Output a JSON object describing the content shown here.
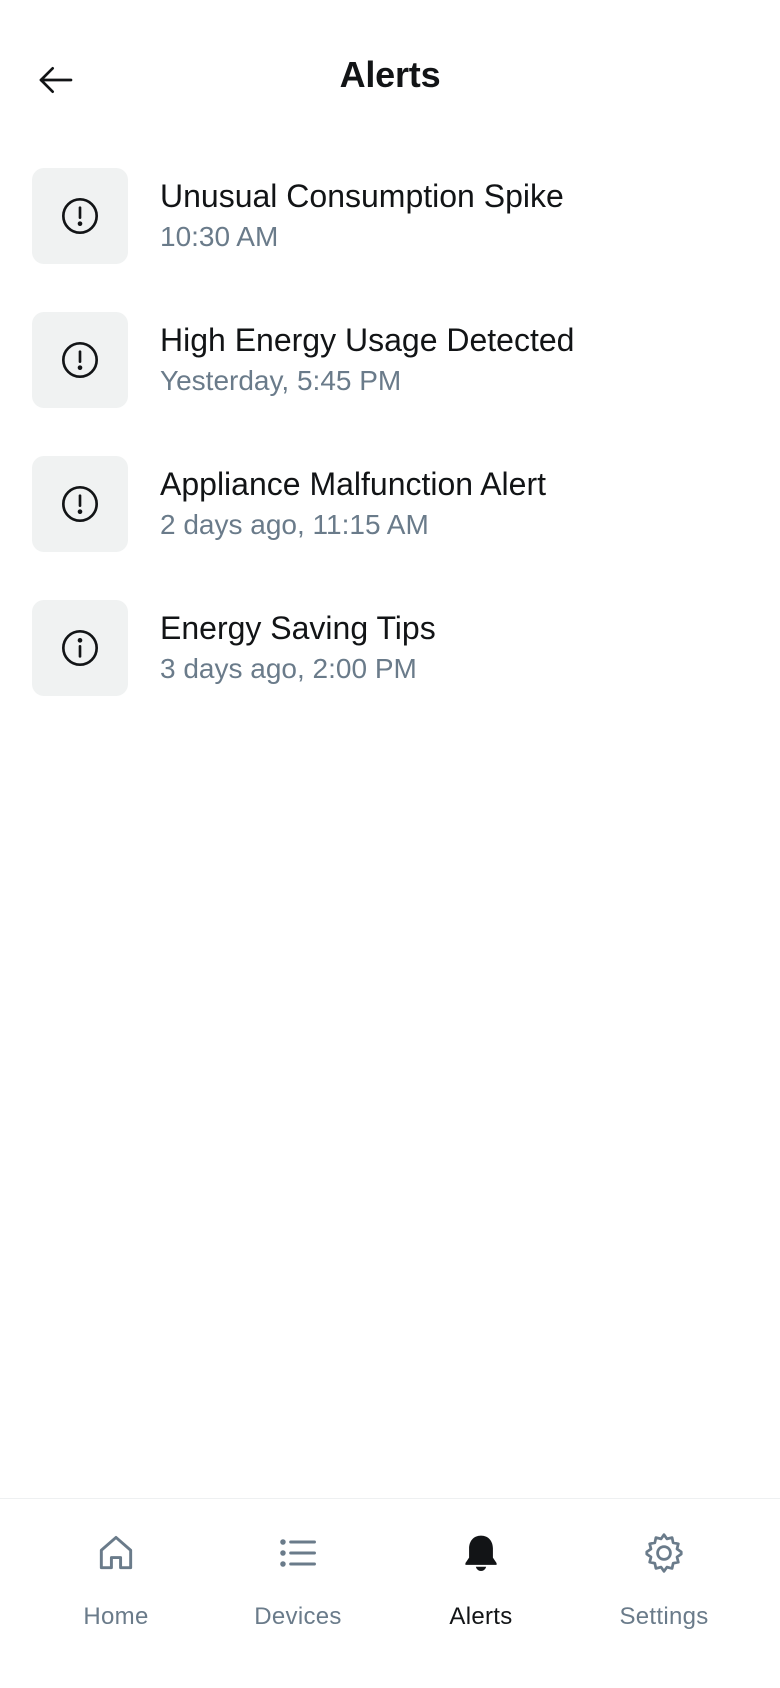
{
  "header": {
    "title": "Alerts",
    "back_icon": "arrow-left-icon"
  },
  "alerts": [
    {
      "title": "Unusual Consumption Spike",
      "time": "10:30 AM",
      "icon": "exclamation-circle-icon"
    },
    {
      "title": "High Energy Usage Detected",
      "time": "Yesterday, 5:45 PM",
      "icon": "exclamation-circle-icon"
    },
    {
      "title": "Appliance Malfunction Alert",
      "time": "2 days ago, 11:15 AM",
      "icon": "exclamation-circle-icon"
    },
    {
      "title": "Energy Saving Tips",
      "time": "3 days ago, 2:00 PM",
      "icon": "info-circle-icon"
    }
  ],
  "nav": {
    "items": [
      {
        "label": "Home",
        "icon": "house-icon",
        "active": false
      },
      {
        "label": "Devices",
        "icon": "list-icon",
        "active": false
      },
      {
        "label": "Alerts",
        "icon": "bell-icon",
        "active": true
      },
      {
        "label": "Settings",
        "icon": "gear-icon",
        "active": false
      }
    ]
  },
  "colors": {
    "text_primary": "#121416",
    "text_secondary": "#6a7b8a",
    "icon_box_bg": "#f0f2f2",
    "background": "#ffffff"
  }
}
